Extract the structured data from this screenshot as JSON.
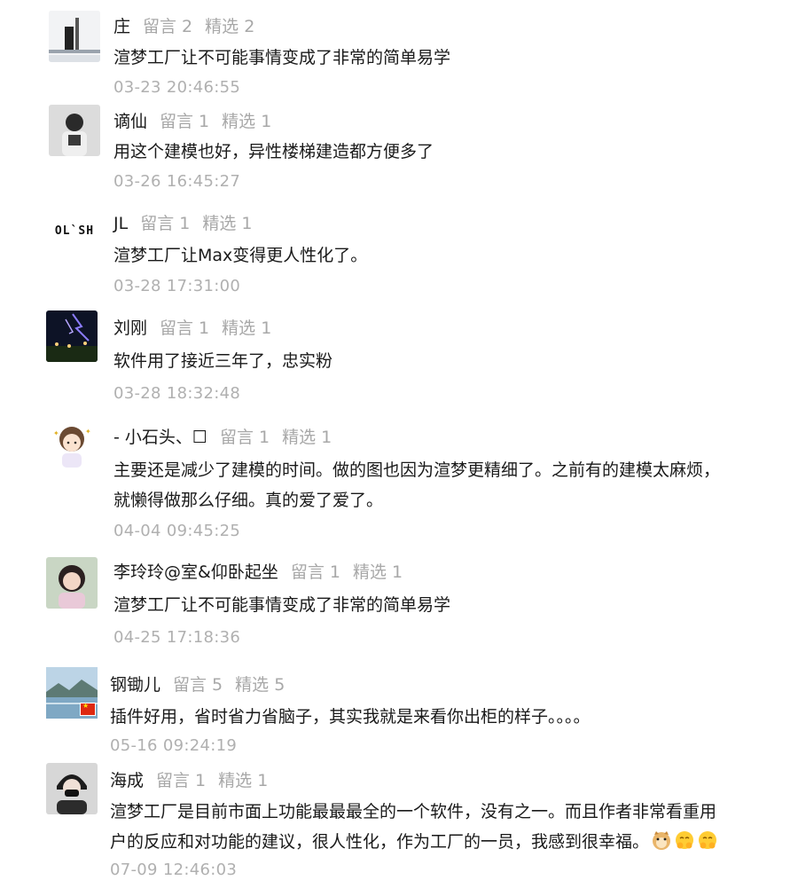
{
  "comments": [
    {
      "name": "庄",
      "comments_label": "留言 2",
      "featured_label": "精选 2",
      "text": "渲梦工厂让不可能事情变成了非常的简单易学",
      "time": "03-23 20:46:55",
      "avatar": "desk-lamp-photo"
    },
    {
      "name": "谪仙",
      "comments_label": "留言 1",
      "featured_label": "精选 1",
      "text": "用这个建模也好，异性楼梯建造都方便多了",
      "time": "03-26 16:45:27",
      "avatar": "person-photo"
    },
    {
      "name": "JL",
      "comments_label": "留言 1",
      "featured_label": "精选 1",
      "text": "渲梦工厂让Max变得更人性化了。",
      "time": "03-28 17:31:00",
      "avatar": "ol-sh-logo",
      "avatar_text": "OL`SH"
    },
    {
      "name": "刘刚",
      "comments_label": "留言 1",
      "featured_label": "精选 1",
      "text": "软件用了接近三年了，忠实粉",
      "time": "03-28 18:32:48",
      "avatar": "night-sky-photo"
    },
    {
      "name": "- 小石头、☐",
      "comments_label": "留言 1",
      "featured_label": "精选 1",
      "text": "主要还是减少了建模的时间。做的图也因为渲梦更精细了。之前有的建模太麻烦，",
      "text2": "就懒得做那么仔细。真的爱了爱了。",
      "time": "04-04 09:45:25",
      "avatar": "cartoon-girl-drawing"
    },
    {
      "name": "李玲玲@室&仰卧起坐",
      "comments_label": "留言 1",
      "featured_label": "精选 1",
      "text": "渲梦工厂让不可能事情变成了非常的简单易学",
      "time": "04-25 17:18:36",
      "avatar": "woman-portrait-photo"
    },
    {
      "name": "钢锄儿",
      "comments_label": "留言 5",
      "featured_label": "精选 5",
      "text": "插件好用，省时省力省脑子，其实我就是来看你出柜的样子。。。。",
      "time": "05-16 09:24:19",
      "avatar": "lake-landscape-photo"
    },
    {
      "name": "海成",
      "comments_label": "留言 1",
      "featured_label": "精选 1",
      "text": "渲梦工厂是目前市面上功能最最最全的一个软件，没有之一。而且作者非常看重用",
      "text2": "户的反应和对功能的建议，很人性化，作为工厂的一员，我感到很幸福。",
      "time": "07-09 12:46:03",
      "avatar": "masked-person-photo",
      "emojis": [
        "doge-icon",
        "hug-face-icon",
        "hug-face-icon"
      ]
    }
  ],
  "colors": {
    "text": "#1a1a1a",
    "meta": "#a8a8a8",
    "time": "#b0b0b0"
  }
}
